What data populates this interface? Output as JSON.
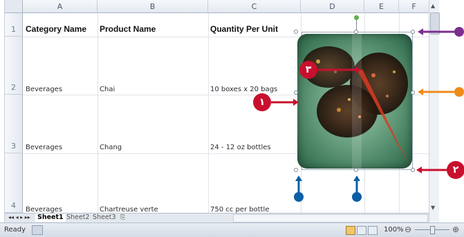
{
  "columns": [
    "A",
    "B",
    "C",
    "D",
    "E",
    "F"
  ],
  "rows": [
    {
      "num": "1",
      "a": "Category Name",
      "b": "Product Name",
      "c": "Quantity Per Unit"
    },
    {
      "num": "2",
      "a": "Beverages",
      "b": "Chai",
      "c": "10 boxes x 20 bags"
    },
    {
      "num": "3",
      "a": "Beverages",
      "b": "Chang",
      "c": "24 - 12 oz bottles"
    },
    {
      "num": "4",
      "a": "Beverages",
      "b": "Chartreuse verte",
      "c": "750 cc per bottle"
    }
  ],
  "sheets": [
    "Sheet1",
    "Sheet2",
    "Sheet3"
  ],
  "status": {
    "ready": "Ready",
    "zoom": "100%"
  },
  "callouts": {
    "one": "١",
    "two": "٢",
    "three": "٣"
  },
  "colors": {
    "callout_red": "#c8102e",
    "callout_purple": "#7b2e8e",
    "callout_orange": "#f08a1c",
    "callout_blue": "#0b5fa5"
  }
}
